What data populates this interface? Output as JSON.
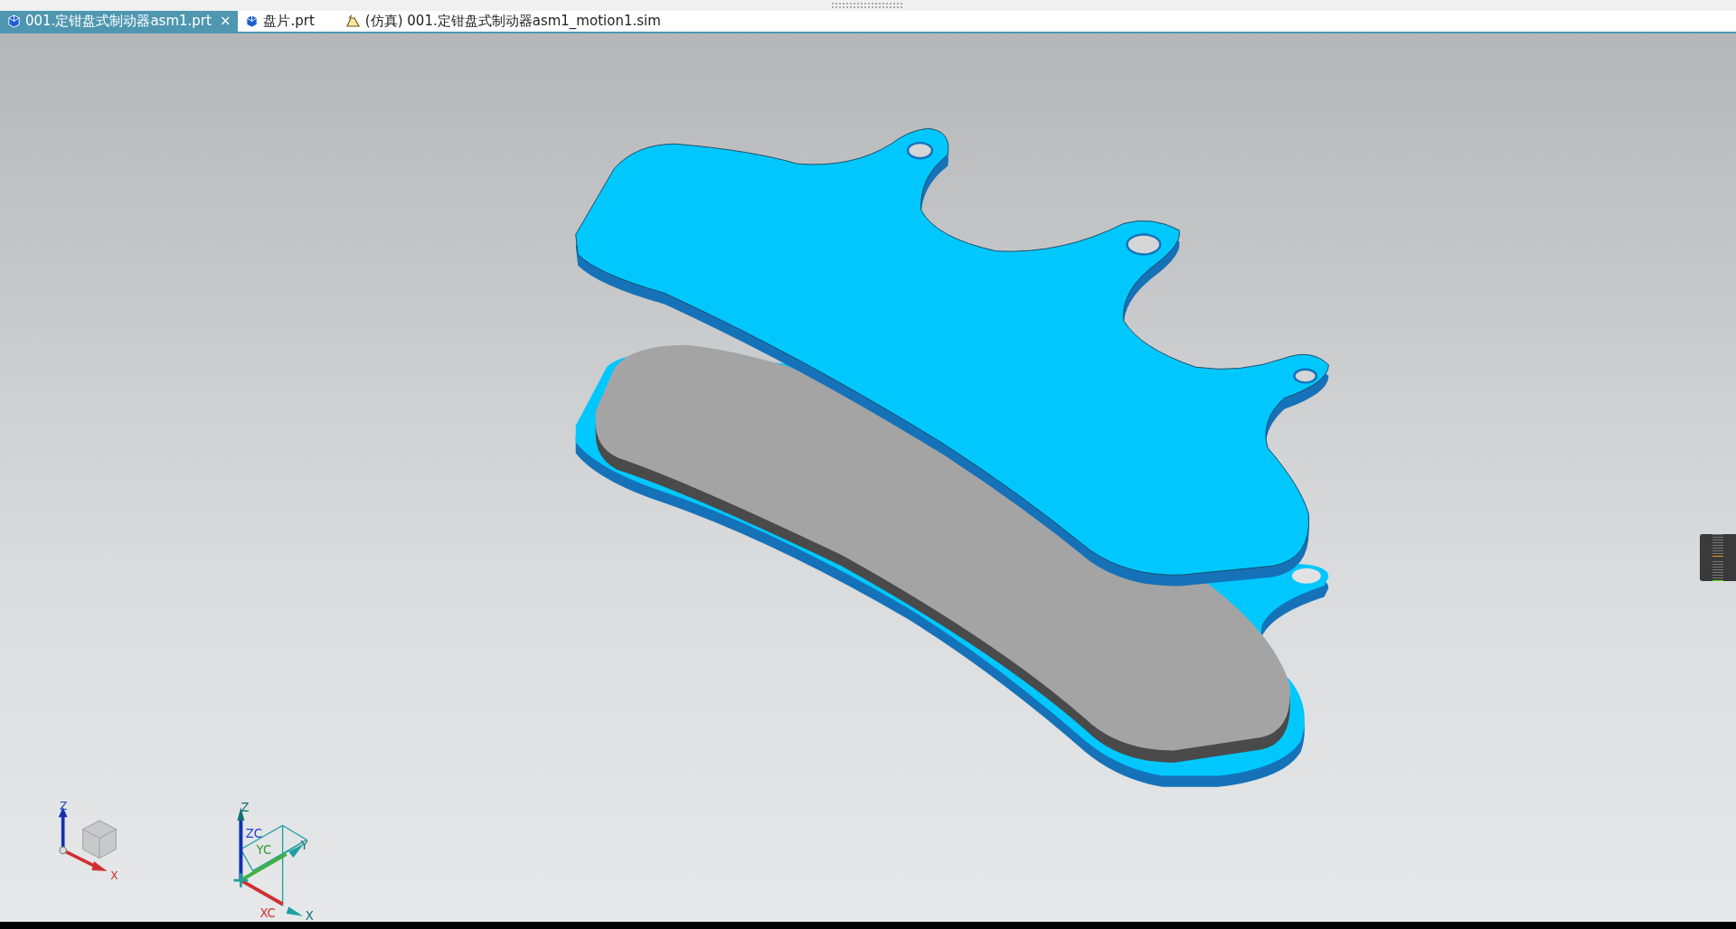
{
  "tabs": [
    {
      "label": "001.定钳盘式制动器asm1.prt",
      "kind": "part",
      "selected": true,
      "close": "×"
    },
    {
      "label": "盘片.prt",
      "kind": "part",
      "selected": false
    },
    {
      "label": "(仿真) 001.定钳盘式制动器asm1_motion1.sim",
      "kind": "simulation",
      "selected": false
    }
  ],
  "absolute_triad": {
    "labels": [
      "Z",
      "X"
    ]
  },
  "wcs_triad": {
    "labels": [
      "Z",
      "ZC",
      "YC",
      "Y",
      "XC",
      "X"
    ]
  }
}
